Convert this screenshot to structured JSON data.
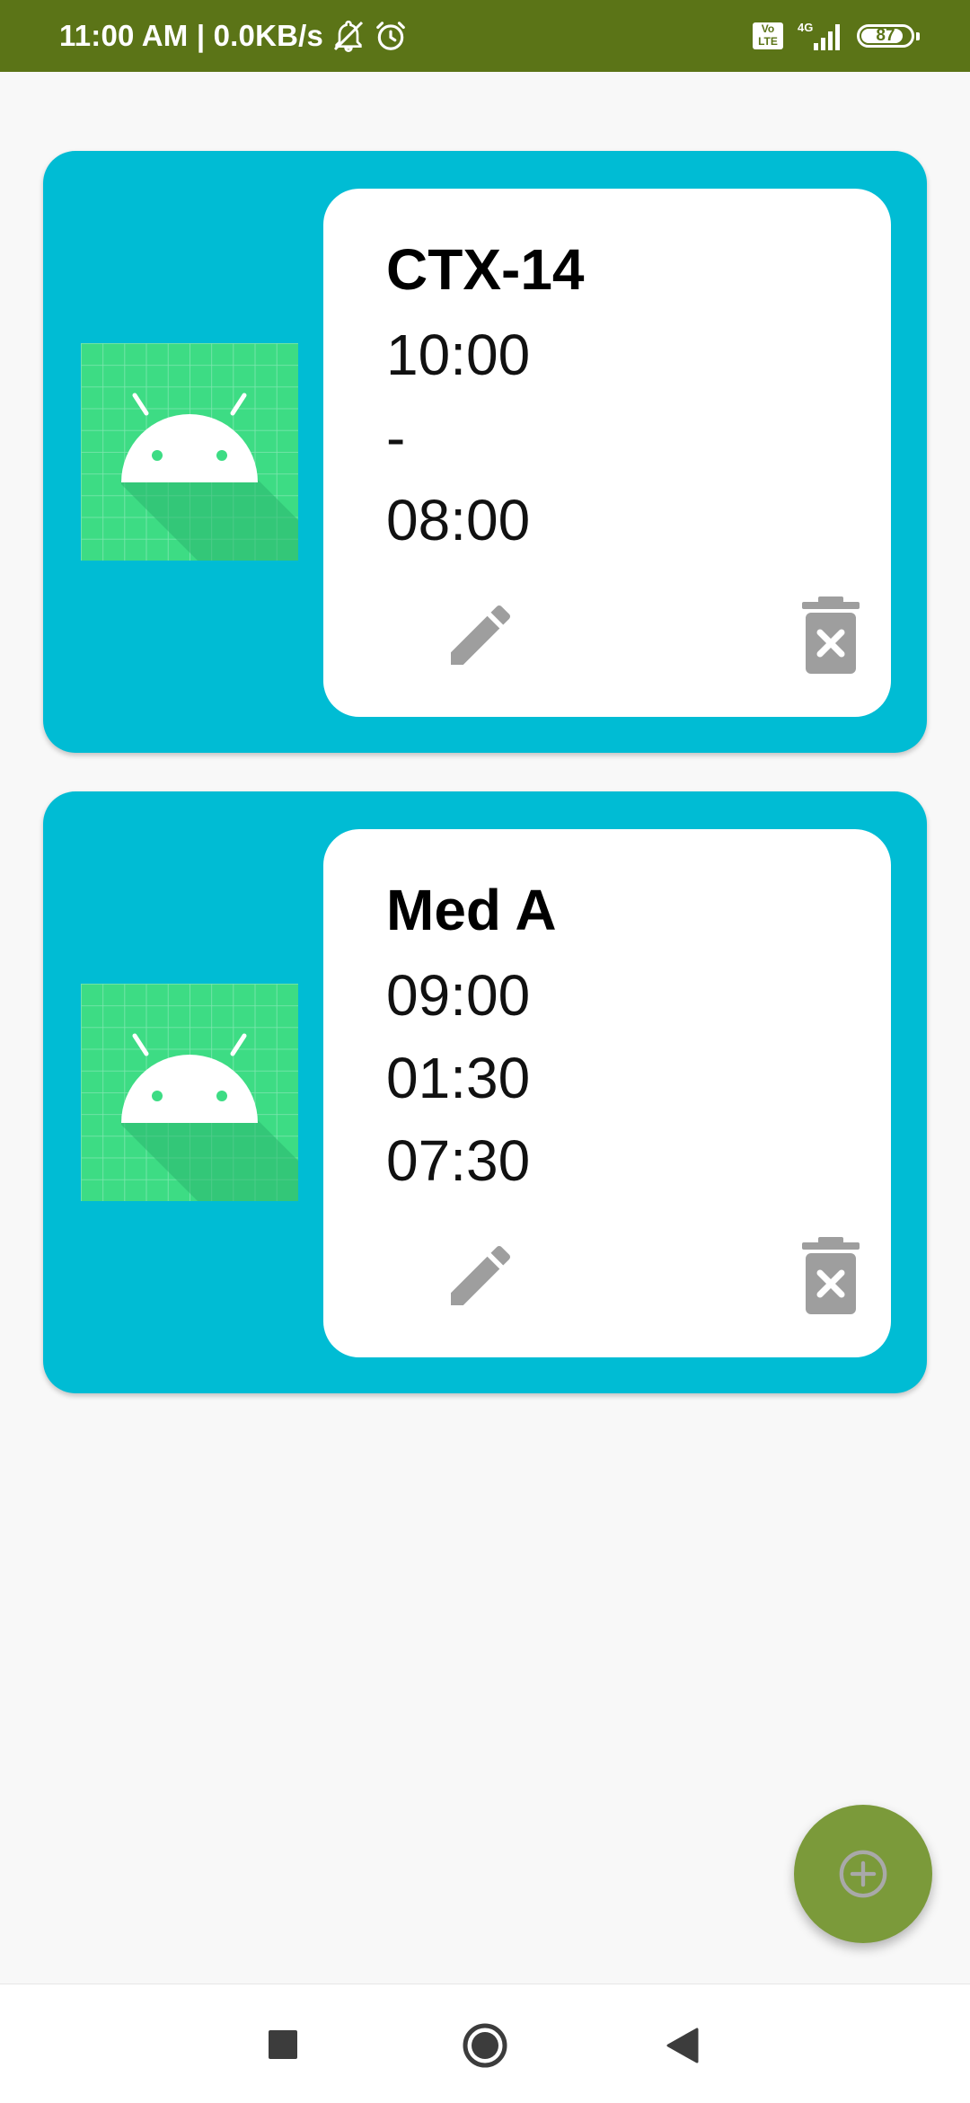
{
  "status_bar": {
    "time_speed": "11:00 AM | 0.0KB/s",
    "network": "4G",
    "volte": "Vo LTE",
    "battery": "87",
    "battery_level": 0.87,
    "icons": [
      "notifications-off-icon",
      "alarm-icon",
      "volte-icon",
      "signal-icon",
      "battery-icon"
    ]
  },
  "medications": [
    {
      "name": "CTX-14",
      "times": [
        "10:00",
        "-",
        "08:00"
      ],
      "image_icon": "android-placeholder-image"
    },
    {
      "name": "Med A",
      "times": [
        "09:00",
        "01:30",
        "07:30"
      ],
      "image_icon": "android-placeholder-image"
    }
  ],
  "actions": {
    "edit_icon": "pencil-icon",
    "delete_icon": "trash-icon"
  },
  "fab": {
    "icon": "add-circle-icon"
  },
  "navigation": {
    "icons": [
      "recents-icon",
      "home-icon",
      "back-icon"
    ]
  },
  "colors": {
    "status_bar": "#5b7417",
    "card": "#00bcd4",
    "inner_card": "#ffffff",
    "fab": "#7b9a3a",
    "action_icon": "#9e9e9e",
    "background": "#f8f8f8"
  }
}
